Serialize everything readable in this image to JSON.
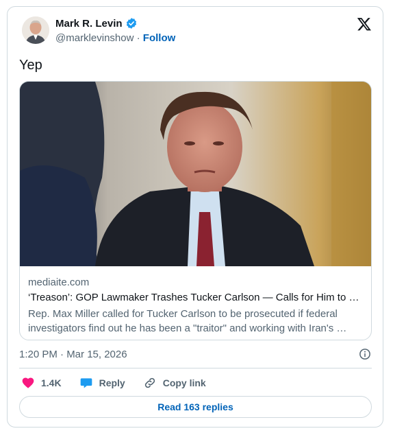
{
  "author": {
    "name": "Mark R. Levin",
    "handle": "@marklevinshow",
    "separator": "·",
    "follow_label": "Follow",
    "verified_color": "#1d9bf0"
  },
  "tweet": {
    "text": "Yep"
  },
  "link_card": {
    "domain": "mediaite.com",
    "title": "‘Treason’: GOP Lawmaker Trashes Tucker Carlson — Calls for Him to …",
    "description": "Rep. Max Miller called for Tucker Carlson to be prosecuted if federal investigators find out he has been a \"traitor\" and working with Iran's …"
  },
  "meta": {
    "timestamp": "1:20 PM · Mar 15, 2026"
  },
  "actions": {
    "like_count": "1.4K",
    "reply_label": "Reply",
    "copy_link_label": "Copy link",
    "like_color": "#f91880",
    "reply_color": "#1d9bf0"
  },
  "footer": {
    "read_replies_label": "Read 163 replies"
  }
}
